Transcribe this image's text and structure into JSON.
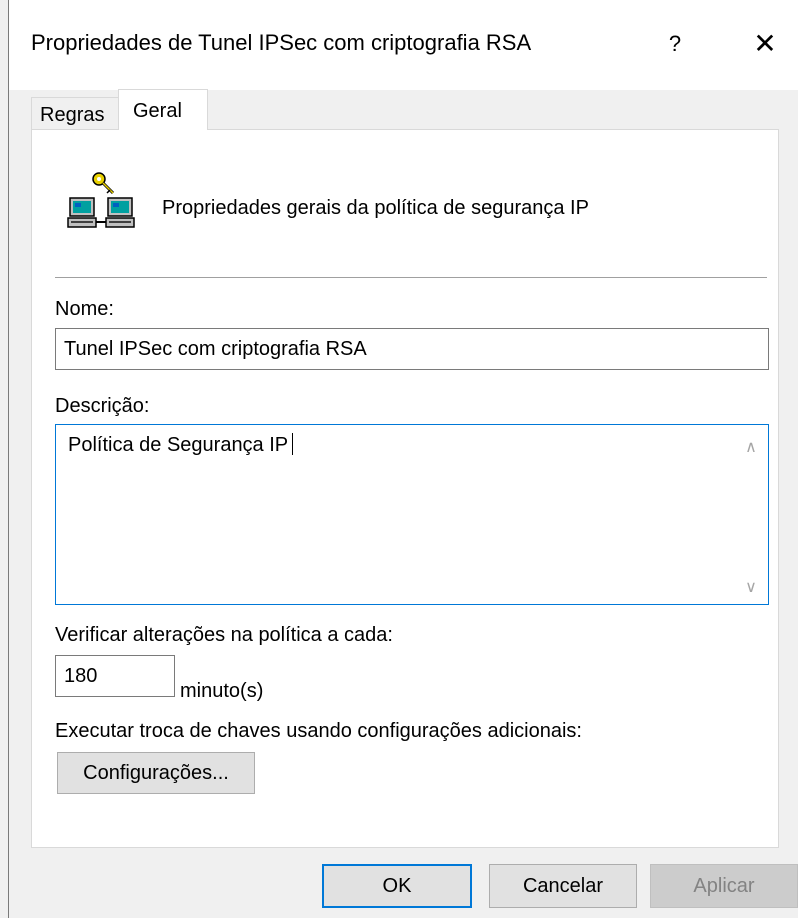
{
  "window": {
    "title": "Propriedades de Tunel IPSec com criptografia RSA",
    "help_label": "?",
    "close_label": "✕"
  },
  "tabs": [
    {
      "label": "Regras",
      "active": false
    },
    {
      "label": "Geral",
      "active": true
    }
  ],
  "general": {
    "header_text": "Propriedades gerais da política de segurança IP",
    "header_icon": "ip-security-policy-icon",
    "name_label": "Nome:",
    "name_value": "Tunel IPSec com criptografia RSA",
    "description_label": "Descrição:",
    "description_value": "Política de Segurança IP",
    "check_label": "Verificar alterações na política a cada:",
    "check_value": "180",
    "check_unit": "minuto(s)",
    "key_exchange_label": "Executar troca de chaves usando configurações adicionais:",
    "settings_button": "Configurações..."
  },
  "footer": {
    "ok_label": "OK",
    "cancel_label": "Cancelar",
    "apply_label": "Aplicar",
    "apply_enabled": false
  },
  "colors": {
    "focus_border": "#0078d7",
    "dialog_bg": "#f0f0f0",
    "panel_bg": "#ffffff"
  }
}
